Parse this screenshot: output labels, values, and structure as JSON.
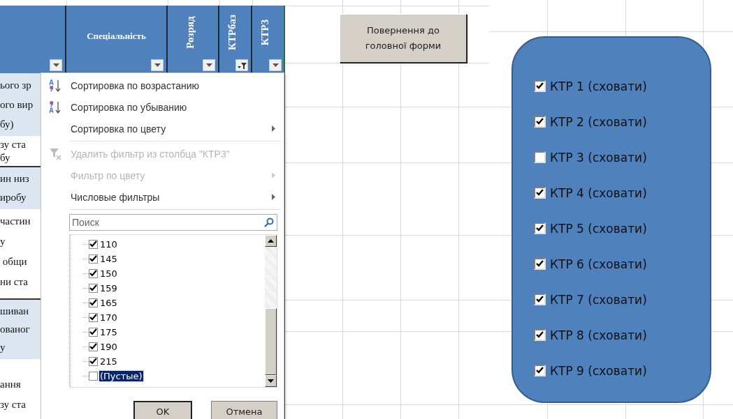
{
  "table": {
    "columns": [
      {
        "filter_active": false
      },
      {
        "kind": "horizontal",
        "label": "Спеціальність",
        "filter_active": false
      },
      {
        "kind": "vertical",
        "label": "Розряд",
        "filter_active": false
      },
      {
        "kind": "vertical",
        "label": "КТРбаз",
        "filter_active": true
      },
      {
        "kind": "vertical",
        "label": "КТР3",
        "filter_active": false
      }
    ],
    "rows": [
      {
        "shaded": true,
        "lines": [
          "ього зр",
          "ого вир",
          "бу)"
        ]
      },
      {
        "shaded": false,
        "lines": [
          "зу ста",
          "бу"
        ]
      },
      {
        "shaded": true,
        "lines": [
          "ин низ",
          "иробу"
        ]
      },
      {
        "shaded": false,
        "lines": [
          "частин",
          "у",
          " общи",
          "ни ста"
        ]
      },
      {
        "shaded": true,
        "lines": [
          "шиван",
          "ованог",
          "у"
        ]
      },
      {
        "shaded": false,
        "lines": [
          "ання",
          "зу ста"
        ]
      }
    ]
  },
  "filter_menu": {
    "items": [
      {
        "kind": "sort_asc",
        "label": "Сортировка по возрастанию",
        "disabled": false,
        "submenu": false
      },
      {
        "kind": "sort_desc",
        "label": "Сортировка по убыванию",
        "disabled": false,
        "submenu": false
      },
      {
        "kind": "plain",
        "label": "Сортировка по цвету",
        "disabled": false,
        "submenu": true
      },
      {
        "kind": "clear_filter",
        "label": "Удалить фильтр из столбца \"КТР3\"",
        "disabled": true,
        "submenu": false
      },
      {
        "kind": "plain",
        "label": "Фильтр по цвету",
        "disabled": true,
        "submenu": true
      },
      {
        "kind": "plain",
        "label": "Числовые фильтры",
        "disabled": false,
        "submenu": true
      }
    ],
    "search": {
      "placeholder": "Поиск"
    },
    "values": [
      {
        "label": "110",
        "checked": true,
        "selected": false
      },
      {
        "label": "145",
        "checked": true,
        "selected": false
      },
      {
        "label": "150",
        "checked": true,
        "selected": false
      },
      {
        "label": "159",
        "checked": true,
        "selected": false
      },
      {
        "label": "165",
        "checked": true,
        "selected": false
      },
      {
        "label": "170",
        "checked": true,
        "selected": false
      },
      {
        "label": "175",
        "checked": true,
        "selected": false
      },
      {
        "label": "190",
        "checked": true,
        "selected": false
      },
      {
        "label": "215",
        "checked": true,
        "selected": false
      },
      {
        "label": "(Пустые)",
        "checked": false,
        "selected": true
      }
    ],
    "buttons": [
      {
        "label": "OK",
        "default": true
      },
      {
        "label": "Отмена",
        "default": false
      }
    ]
  },
  "sheet_button": {
    "label": "Повернення до головної форми"
  },
  "panel": {
    "checkboxes": [
      {
        "label": "КТР 1 (сховати)",
        "checked": true
      },
      {
        "label": "КТР 2 (сховати)",
        "checked": true
      },
      {
        "label": "КТР 3 (сховати)",
        "checked": false
      },
      {
        "label": "КТР 4 (сховати)",
        "checked": true
      },
      {
        "label": "КТР 5 (сховати)",
        "checked": true
      },
      {
        "label": "КТР 6 (сховати)",
        "checked": true
      },
      {
        "label": "КТР 7 (сховати)",
        "checked": true
      },
      {
        "label": "КТР 8 (сховати)",
        "checked": true
      },
      {
        "label": "КТР 9 (сховати)",
        "checked": true
      }
    ]
  }
}
